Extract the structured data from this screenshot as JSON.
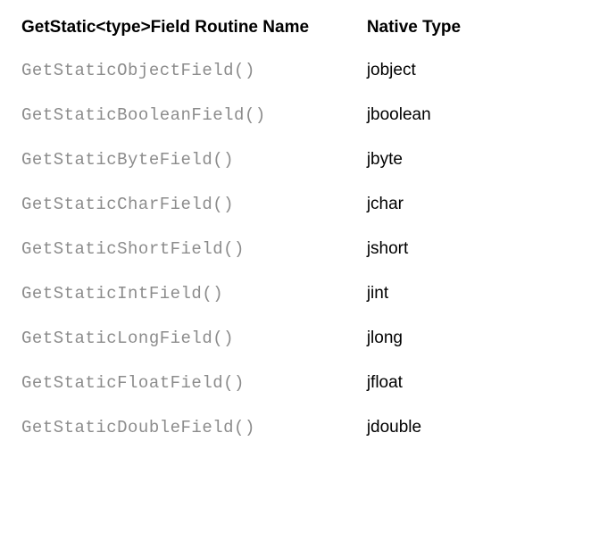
{
  "headers": {
    "routine": "GetStatic<type>Field Routine Name",
    "native_type": "Native Type"
  },
  "rows": [
    {
      "routine": "GetStaticObjectField()",
      "native_type": "jobject"
    },
    {
      "routine": "GetStaticBooleanField()",
      "native_type": "jboolean"
    },
    {
      "routine": "GetStaticByteField()",
      "native_type": "jbyte"
    },
    {
      "routine": "GetStaticCharField()",
      "native_type": "jchar"
    },
    {
      "routine": "GetStaticShortField()",
      "native_type": "jshort"
    },
    {
      "routine": "GetStaticIntField()",
      "native_type": "jint"
    },
    {
      "routine": "GetStaticLongField()",
      "native_type": "jlong"
    },
    {
      "routine": "GetStaticFloatField()",
      "native_type": "jfloat"
    },
    {
      "routine": "GetStaticDoubleField()",
      "native_type": "jdouble"
    }
  ]
}
